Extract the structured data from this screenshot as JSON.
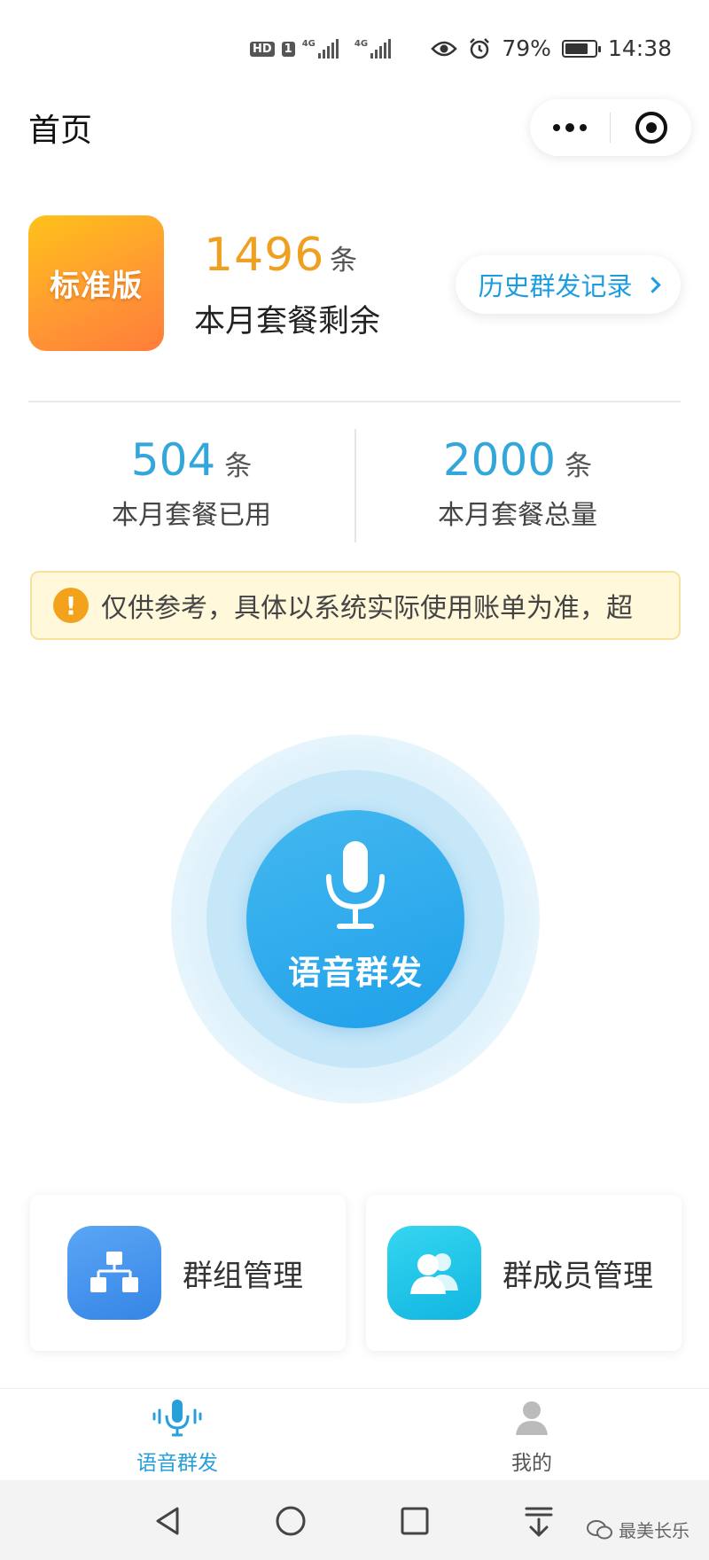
{
  "status_bar": {
    "hd_label": "HD",
    "sim1_label": "1",
    "net1": "4G",
    "net2": "4G",
    "battery_percent": "79%",
    "battery_level": 0.79,
    "time": "14:38"
  },
  "header": {
    "title": "首页"
  },
  "plan": {
    "badge": "标准版",
    "remaining_value": "1496",
    "remaining_unit": "条",
    "remaining_label": "本月套餐剩余",
    "history_button": "历史群发记录"
  },
  "stats": [
    {
      "value": "504",
      "unit": "条",
      "label": "本月套餐已用"
    },
    {
      "value": "2000",
      "unit": "条",
      "label": "本月套餐总量"
    }
  ],
  "notice": {
    "icon": "!",
    "text": "仅供参考，具体以系统实际使用账单为准，超"
  },
  "voice_button": {
    "label": "语音群发"
  },
  "cards": [
    {
      "label": "群组管理"
    },
    {
      "label": "群成员管理"
    }
  ],
  "tabbar": [
    {
      "label": "语音群发",
      "active": true
    },
    {
      "label": "我的",
      "active": false
    }
  ],
  "watermark": "最美长乐",
  "colors": {
    "accent_blue": "#1fa0ea",
    "remaining_orange": "#f0a020",
    "stat_blue": "#33a7db",
    "notice_bg": "#fff8da"
  }
}
